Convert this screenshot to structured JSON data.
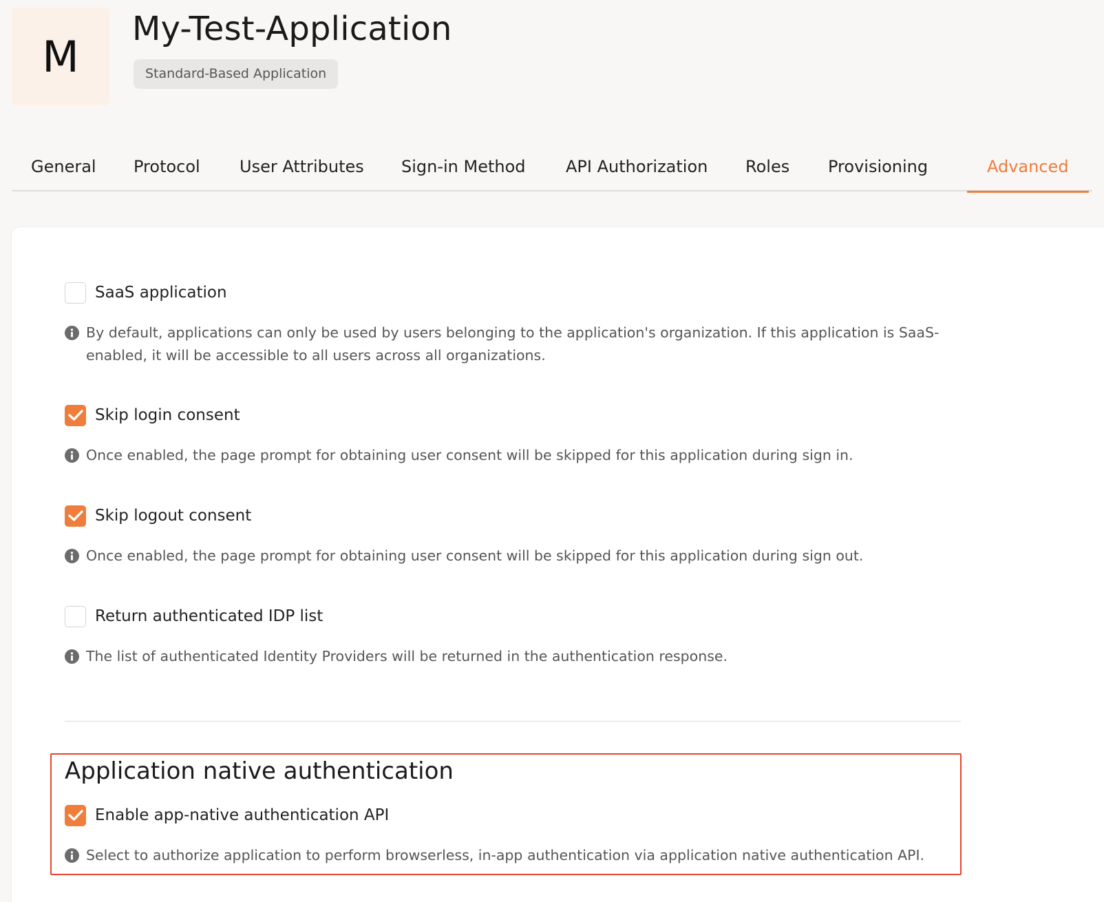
{
  "app": {
    "avatar_letter": "M",
    "title": "My-Test-Application",
    "type_badge": "Standard-Based Application"
  },
  "tabs": [
    {
      "label": "General",
      "active": false
    },
    {
      "label": "Protocol",
      "active": false
    },
    {
      "label": "User Attributes",
      "active": false
    },
    {
      "label": "Sign-in Method",
      "active": false
    },
    {
      "label": "API Authorization",
      "active": false
    },
    {
      "label": "Roles",
      "active": false
    },
    {
      "label": "Provisioning",
      "active": false
    },
    {
      "label": "Advanced",
      "active": true
    }
  ],
  "options": {
    "saas": {
      "label": "SaaS application",
      "checked": false,
      "hint": "By default, applications can only be used by users belonging to the application's organization. If this application is SaaS-enabled, it will be accessible to all users across all organizations."
    },
    "skip_login_consent": {
      "label": "Skip login consent",
      "checked": true,
      "hint": "Once enabled, the page prompt for obtaining user consent will be skipped for this application during sign in."
    },
    "skip_logout_consent": {
      "label": "Skip logout consent",
      "checked": true,
      "hint": "Once enabled, the page prompt for obtaining user consent will be skipped for this application during sign out."
    },
    "return_idp_list": {
      "label": "Return authenticated IDP list",
      "checked": false,
      "hint": "The list of authenticated Identity Providers will be returned in the authentication response."
    }
  },
  "native_auth": {
    "section_title": "Application native authentication",
    "label": "Enable app-native authentication API",
    "checked": true,
    "hint": "Select to authorize application to perform browserless, in-app authentication via application native authentication API."
  },
  "colors": {
    "accent": "#ef7d3c",
    "highlight_border": "#e5452e",
    "background": "#f8f7f5",
    "avatar_bg": "#fcf1e8"
  }
}
